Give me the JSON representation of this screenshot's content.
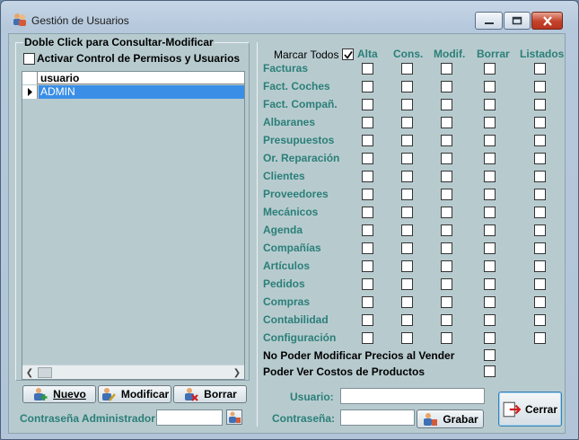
{
  "window": {
    "title": "Gestión de Usuarios",
    "accent": "#3a8ee6",
    "label_color": "#2b7f78"
  },
  "left": {
    "group_title": "Doble Click para Consultar-Modificar",
    "activar_label": "Activar Control de Permisos y Usuarios",
    "activar_checked": false,
    "grid": {
      "column": "usuario",
      "rows": [
        "ADMIN"
      ],
      "selected": 0
    },
    "buttons": {
      "nuevo": "Nuevo",
      "modificar": "Modificar",
      "borrar": "Borrar"
    },
    "admin_pwd_label": "Contraseña Administrador:",
    "admin_pwd_value": ""
  },
  "perms": {
    "marcar_todos_label": "Marcar Todos",
    "marcar_todos_checked": true,
    "columns": [
      "Alta",
      "Cons.",
      "Modif.",
      "Borrar",
      "Listados"
    ],
    "rows": [
      "Facturas",
      "Fact. Coches",
      "Fact. Compañ.",
      "Albaranes",
      "Presupuestos",
      "Or. Reparación",
      "Clientes",
      "Proveedores",
      "Mecánicos",
      "Agenda",
      "Compañías",
      "Artículos",
      "Pedidos",
      "Compras",
      "Contabilidad",
      "Configuración"
    ],
    "checked": []
  },
  "options": {
    "no_modificar_precios": "No Poder Modificar Precios al Vender",
    "ver_costos": "Poder Ver Costos de Productos"
  },
  "user_form": {
    "usuario_label": "Usuario:",
    "usuario_value": "",
    "contrasena_label": "Contraseña:",
    "contrasena_value": "",
    "grabar": "Grabar",
    "cerrar": "Cerrar"
  },
  "icons": {
    "app": "users-icon",
    "nuevo": "add-user-icon",
    "modificar": "edit-user-icon",
    "borrar": "delete-user-icon",
    "cerrar": "exit-icon",
    "grabar": "save-user-icon"
  }
}
